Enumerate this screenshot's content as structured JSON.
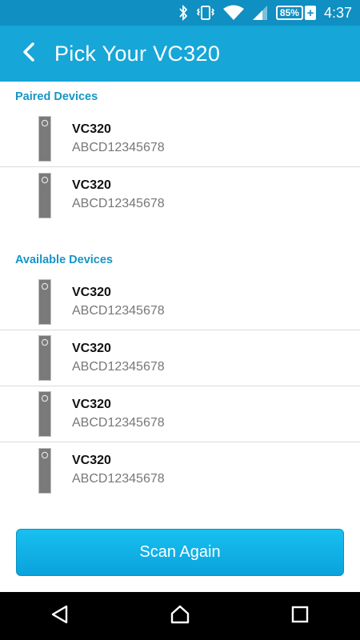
{
  "status_bar": {
    "battery_percent": "85%",
    "battery_charge_symbol": "+",
    "time": "4:37",
    "icons": [
      "bluetooth-icon",
      "vibrate-icon",
      "wifi-icon",
      "cell-signal-icon",
      "battery-icon"
    ]
  },
  "app_bar": {
    "title": "Pick Your VC320",
    "back_icon": "chevron-left-icon"
  },
  "paired": {
    "header": "Paired Devices",
    "devices": [
      {
        "name": "VC320",
        "id": "ABCD12345678"
      },
      {
        "name": "VC320",
        "id": "ABCD12345678"
      }
    ]
  },
  "available": {
    "header": "Available Devices",
    "devices": [
      {
        "name": "VC320",
        "id": "ABCD12345678"
      },
      {
        "name": "VC320",
        "id": "ABCD12345678"
      },
      {
        "name": "VC320",
        "id": "ABCD12345678"
      },
      {
        "name": "VC320",
        "id": "ABCD12345678"
      }
    ]
  },
  "scan_button": {
    "label": "Scan Again"
  },
  "nav_bar": {
    "icons": [
      "back-triangle-icon",
      "home-icon",
      "recents-square-icon"
    ]
  },
  "colors": {
    "status_bar": "#0f8fc2",
    "app_bar": "#16a6d8",
    "section_header": "#1795c6",
    "button": "#0aa2dc"
  }
}
